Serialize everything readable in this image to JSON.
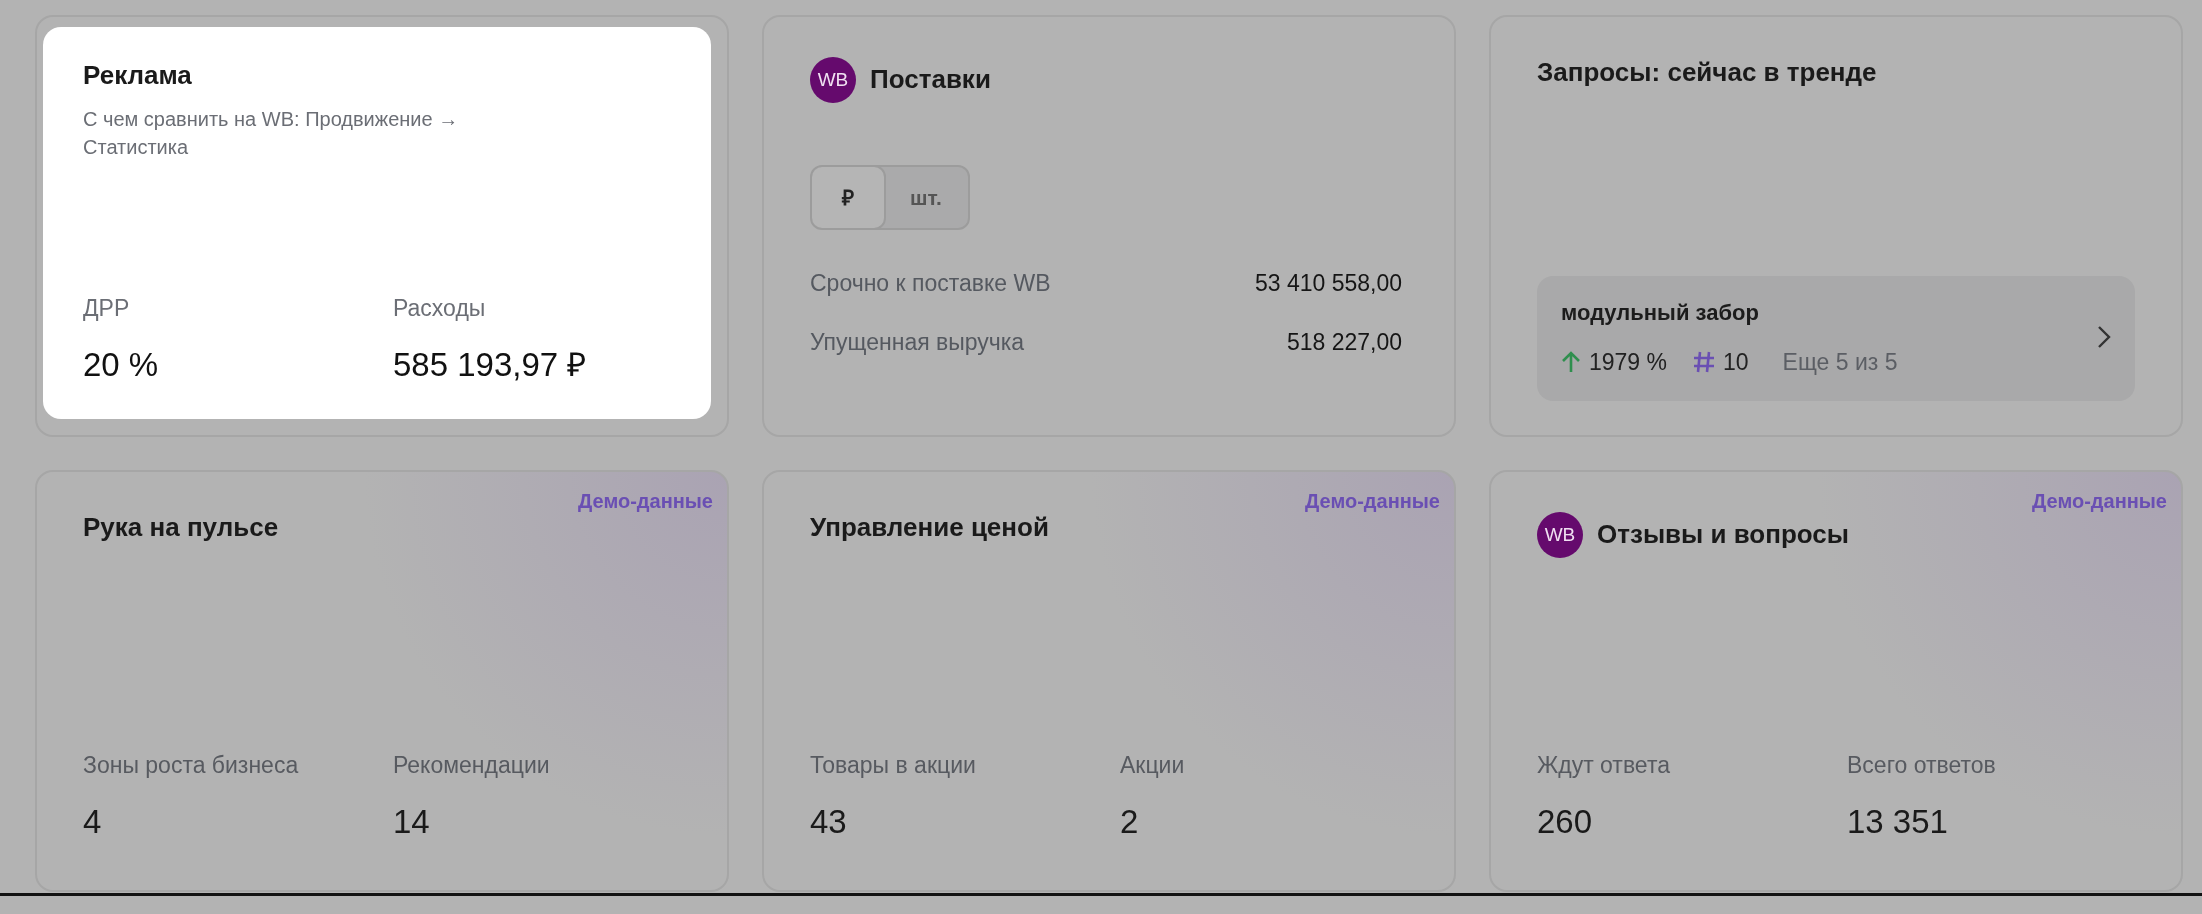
{
  "cards": [
    {
      "kind": "metrics",
      "highlighted": true,
      "title": "Реклама",
      "subtitle": "С чем сравнить на WB: Продвижение → Статистика",
      "metrics": [
        {
          "label": "ДРР",
          "value": "20 %"
        },
        {
          "label": "Расходы",
          "value": "585 193,97 ₽"
        }
      ]
    },
    {
      "kind": "supply",
      "highlighted": false,
      "badge": "WB",
      "title": "Поставки",
      "toggle": [
        {
          "label": "₽",
          "selected": true
        },
        {
          "label": "шт.",
          "selected": false
        }
      ],
      "rows": [
        {
          "label": "Срочно к поставке WB",
          "value": "53 410 558,00"
        },
        {
          "label": "Упущенная выручка",
          "value": "518 227,00"
        }
      ]
    },
    {
      "kind": "trends",
      "highlighted": false,
      "title": "Запросы: сейчас в тренде",
      "trend": {
        "query": "модульный забор",
        "growth": "1979 %",
        "rank": "10",
        "more": "Еще 5 из 5"
      }
    },
    {
      "kind": "metrics",
      "highlighted": false,
      "demo": "Демо-данные",
      "title": "Рука на пульсе",
      "metrics": [
        {
          "label": "Зоны роста бизнеса",
          "value": "4"
        },
        {
          "label": "Рекомендации",
          "value": "14"
        }
      ]
    },
    {
      "kind": "metrics",
      "highlighted": false,
      "demo": "Демо-данные",
      "title": "Управление ценой",
      "metrics": [
        {
          "label": "Товары в акции",
          "value": "43"
        },
        {
          "label": "Акции",
          "value": "2"
        }
      ]
    },
    {
      "kind": "metrics",
      "highlighted": false,
      "demo": "Демо-данные",
      "badge": "WB",
      "title": "Отзывы и вопросы",
      "metrics": [
        {
          "label": "Ждут ответа",
          "value": "260"
        },
        {
          "label": "Всего ответов",
          "value": "13 351"
        }
      ]
    }
  ]
}
